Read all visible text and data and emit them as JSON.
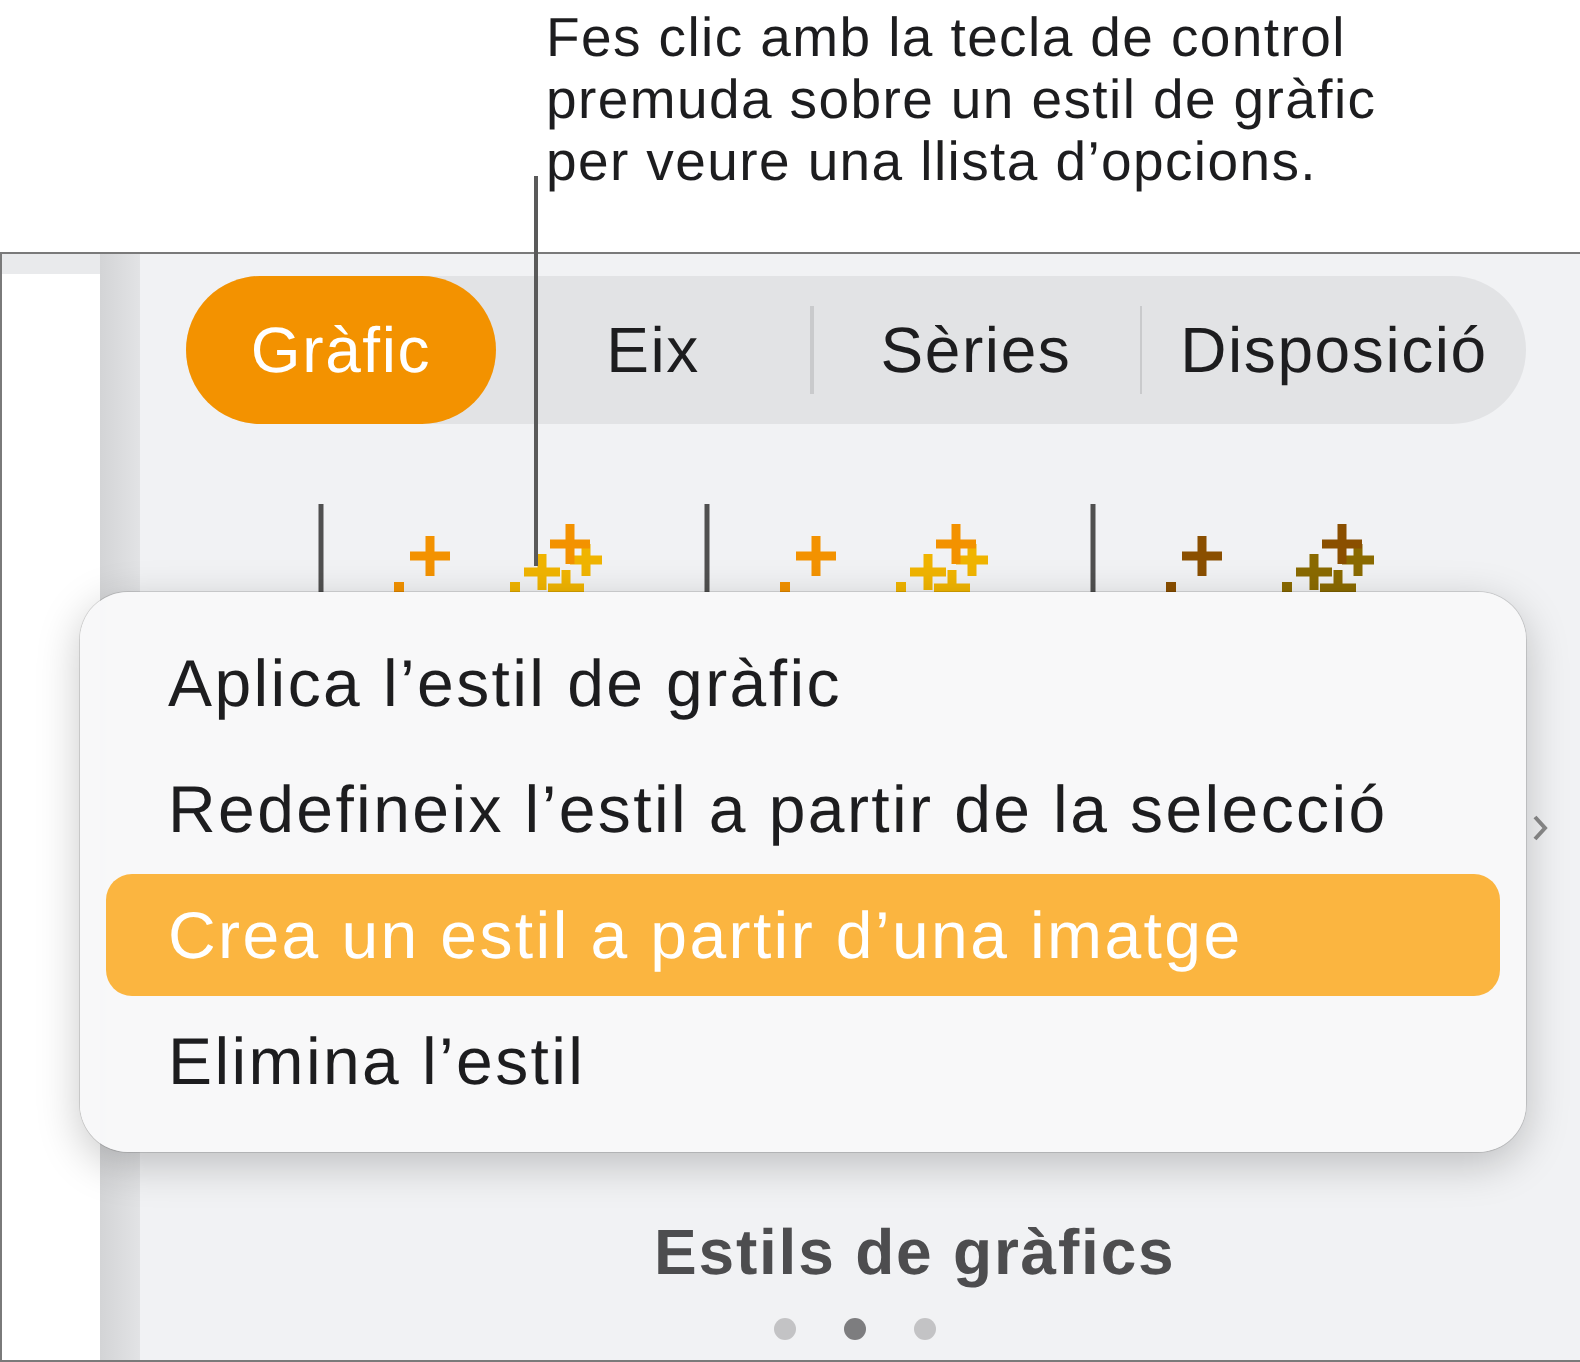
{
  "callout": {
    "text": "Fes clic amb la tecla de control premuda sobre un estil de gràfic per veure una llista d’opcions."
  },
  "tabs": [
    {
      "label": "Gràfic",
      "selected": true
    },
    {
      "label": "Eix",
      "selected": false
    },
    {
      "label": "Sèries",
      "selected": false
    },
    {
      "label": "Disposició",
      "selected": false
    }
  ],
  "chart_styles": [
    {
      "series": [
        {
          "color": "#f39200"
        },
        {
          "color": "#f0b400"
        }
      ]
    },
    {
      "series": [
        {
          "color": "#f39200"
        },
        {
          "color": "#f0b400"
        }
      ]
    },
    {
      "series": [
        {
          "color": "#8a4f00"
        },
        {
          "color": "#8a6a00"
        }
      ]
    }
  ],
  "context_menu": {
    "items": [
      {
        "label": "Aplica l’estil de gràfic",
        "selected": false
      },
      {
        "label": "Redefineix l’estil a partir de la selecció",
        "selected": false
      },
      {
        "label": "Crea un estil a partir d’una imatge",
        "selected": true
      },
      {
        "label": "Elimina l’estil",
        "selected": false
      }
    ]
  },
  "section_title": "Estils de gràfics",
  "page_dots": [
    {
      "selected": false
    },
    {
      "selected": true
    },
    {
      "selected": false
    }
  ]
}
